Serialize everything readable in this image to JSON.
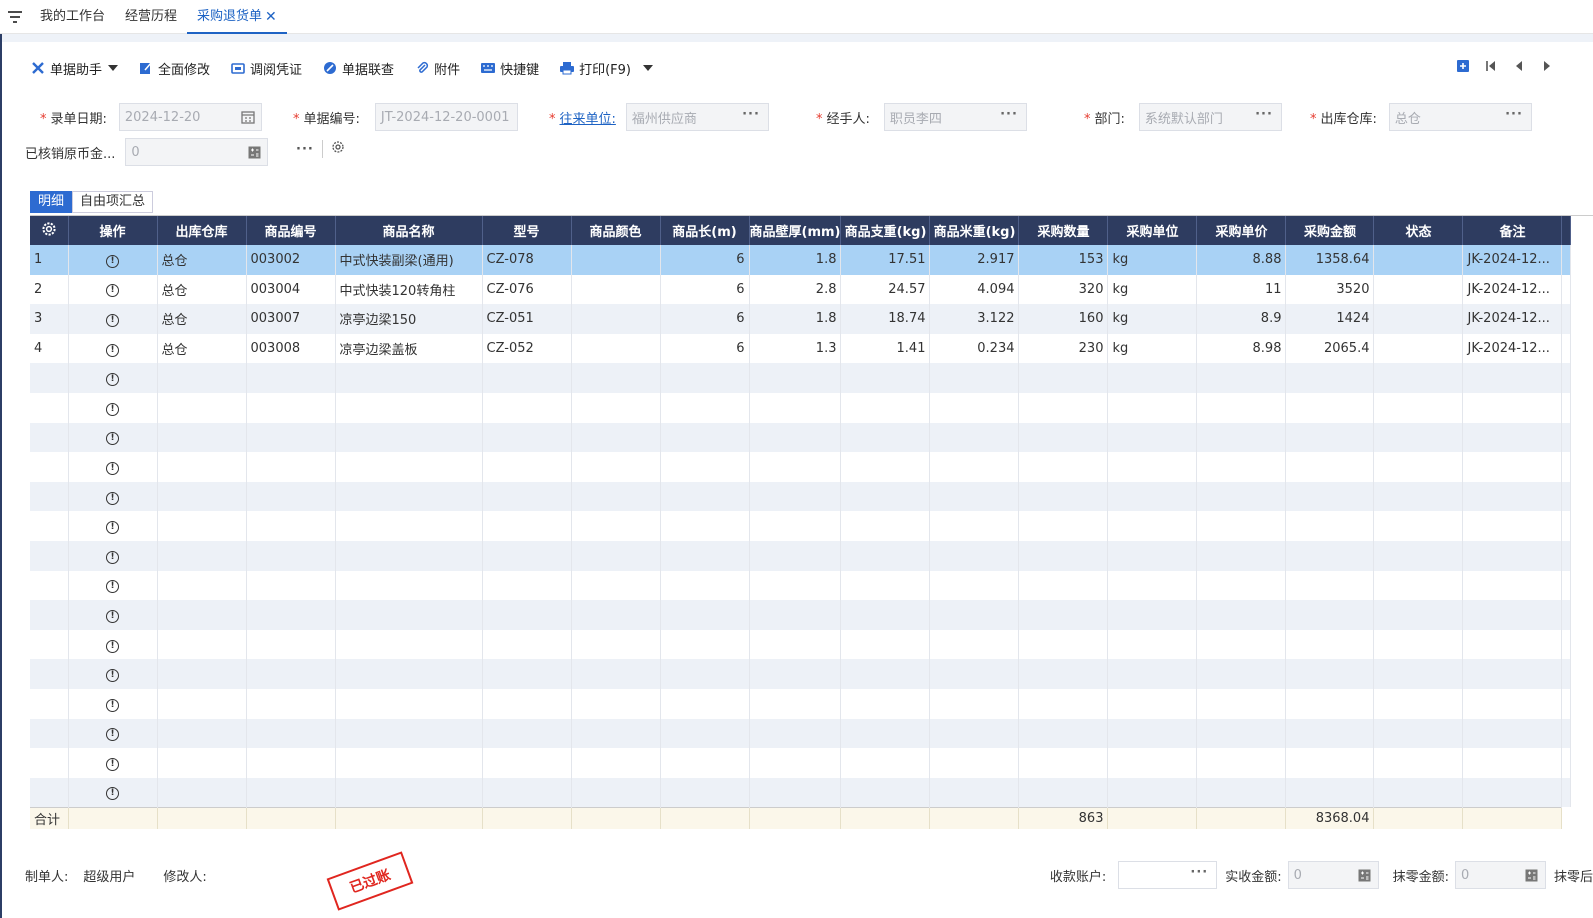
{
  "tabs": [
    {
      "label": "我的工作台"
    },
    {
      "label": "经营历程"
    },
    {
      "label": "采购退货单",
      "active": true
    }
  ],
  "toolbar": {
    "assistant": "单据助手",
    "edit_all": "全面修改",
    "voucher": "调阅凭证",
    "linked_query": "单据联查",
    "attachment": "附件",
    "shortcut": "快捷键",
    "print": "打印(F9)"
  },
  "form": {
    "date_label": "录单日期:",
    "date_value": "2024-12-20",
    "doc_no_label": "单据编号:",
    "doc_no_value": "JT-2024-12-20-0001",
    "partner_label": "往来单位:",
    "partner_value": "福州供应商",
    "handler_label": "经手人:",
    "handler_value": "职员李四",
    "dept_label": "部门:",
    "dept_value": "系统默认部门",
    "warehouse_label": "出库仓库:",
    "warehouse_value": "总仓",
    "written_off_label": "已核销原币金...",
    "written_off_value": "0"
  },
  "detail_tabs": [
    "明细",
    "自由项汇总"
  ],
  "columns": [
    "操作",
    "出库仓库",
    "商品编号",
    "商品名称",
    "型号",
    "商品颜色",
    "商品长(m)",
    "商品壁厚(mm)",
    "商品支重(kg)",
    "商品米重(kg)",
    "采购数量",
    "采购单位",
    "采购单价",
    "采购金额",
    "状态",
    "备注"
  ],
  "rows": [
    {
      "idx": "1",
      "wh": "总仓",
      "code": "003002",
      "name": "中式快装副梁(通用)",
      "model": "CZ-078",
      "color": "",
      "len": "6",
      "thick": "1.8",
      "wt": "17.51",
      "mwt": "2.917",
      "qty": "153",
      "unit": "kg",
      "price": "8.88",
      "amount": "1358.64",
      "status": "",
      "note": "JK-2024-12..."
    },
    {
      "idx": "2",
      "wh": "总仓",
      "code": "003004",
      "name": "中式快装120转角柱",
      "model": "CZ-076",
      "color": "",
      "len": "6",
      "thick": "2.8",
      "wt": "24.57",
      "mwt": "4.094",
      "qty": "320",
      "unit": "kg",
      "price": "11",
      "amount": "3520",
      "status": "",
      "note": "JK-2024-12..."
    },
    {
      "idx": "3",
      "wh": "总仓",
      "code": "003007",
      "name": "凉亭边梁150",
      "model": "CZ-051",
      "color": "",
      "len": "6",
      "thick": "1.8",
      "wt": "18.74",
      "mwt": "3.122",
      "qty": "160",
      "unit": "kg",
      "price": "8.9",
      "amount": "1424",
      "status": "",
      "note": "JK-2024-12..."
    },
    {
      "idx": "4",
      "wh": "总仓",
      "code": "003008",
      "name": "凉亭边梁盖板",
      "model": "CZ-052",
      "color": "",
      "len": "6",
      "thick": "1.3",
      "wt": "1.41",
      "mwt": "0.234",
      "qty": "230",
      "unit": "kg",
      "price": "8.98",
      "amount": "2065.4",
      "status": "",
      "note": "JK-2024-12..."
    }
  ],
  "empty_rows": 15,
  "summary": {
    "label": "合计",
    "qty": "863",
    "amount": "8368.04"
  },
  "footer": {
    "creator_label": "制单人:",
    "creator_value": "超级用户",
    "modifier_label": "修改人:",
    "stamp": "已过账",
    "account_label": "收款账户:",
    "actual_label": "实收金额:",
    "actual_value": "0",
    "rounding_label": "抹零金额:",
    "rounding_value": "0",
    "after_label": "抹零后"
  },
  "colors": {
    "accent": "#2d6bd1",
    "header": "#2e3c60",
    "required": "#e63a2e",
    "stamp": "#e0261f"
  }
}
